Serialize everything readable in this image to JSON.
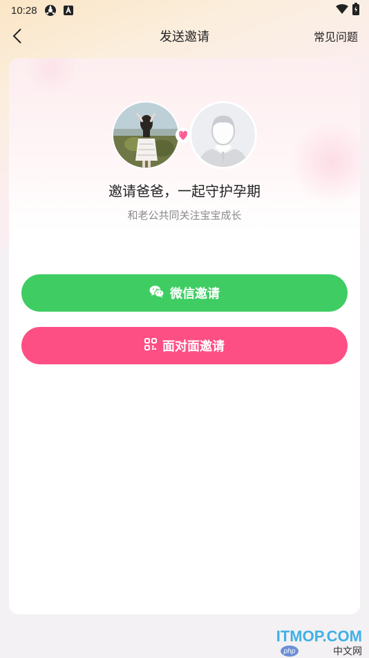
{
  "status_bar": {
    "time": "10:28"
  },
  "nav": {
    "title": "发送邀请",
    "faq": "常见问题"
  },
  "invite": {
    "headline": "邀请爸爸，一起守护孕期",
    "subline": "和老公共同关注宝宝成长"
  },
  "buttons": {
    "wechat_label": "微信邀请",
    "face_to_face_label": "面对面邀请"
  },
  "watermark": {
    "main": "ITMOP.COM",
    "sub": "中文网",
    "badge": "php"
  },
  "colors": {
    "wechat_green": "#3fcd63",
    "pink": "#fe4f85"
  }
}
